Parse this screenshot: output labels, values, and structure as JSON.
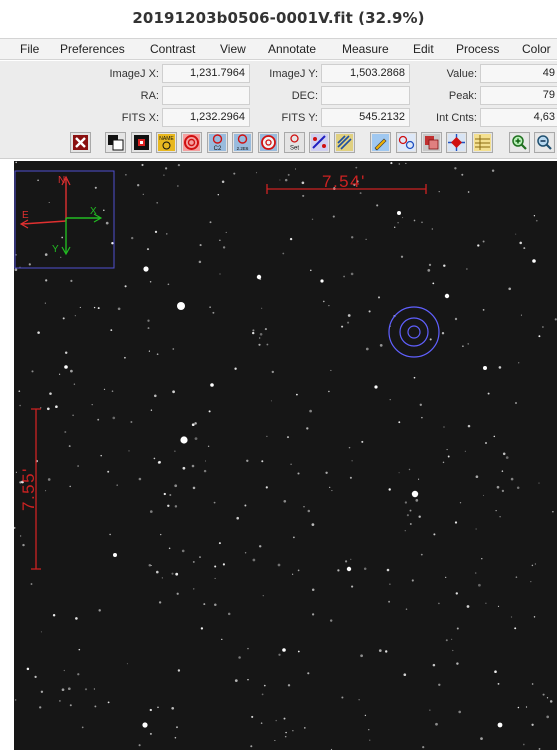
{
  "window": {
    "title": "20191203b0506-0001V.fit (32.9%)"
  },
  "menu": [
    "File",
    "Preferences",
    "Contrast",
    "View",
    "Annotate",
    "Measure",
    "Edit",
    "Process",
    "Color"
  ],
  "info": {
    "imagej_x_label": "ImageJ X:",
    "imagej_x": "1,231.7964",
    "imagej_y_label": "ImageJ Y:",
    "imagej_y": "1,503.2868",
    "value_label": "Value:",
    "value": "49",
    "ra_label": "RA:",
    "ra": "",
    "dec_label": "DEC:",
    "dec": "",
    "peak_label": "Peak:",
    "peak": "79",
    "fits_x_label": "FITS X:",
    "fits_x": "1,232.2964",
    "fits_y_label": "FITS Y:",
    "fits_y": "545.2132",
    "int_cnts_label": "Int Cnts:",
    "int_cnts": "4,63"
  },
  "toolbar": {
    "name_label": "NAME",
    "c2_label": "C2",
    "c2_value": "2.2E6",
    "set_label": "Set"
  },
  "overlay": {
    "scale_horizontal": "7.54'",
    "scale_vertical": "7.55'",
    "compass": {
      "north": "N",
      "east": "E",
      "x": "X",
      "y": "Y"
    }
  },
  "colors": {
    "scale_bar": "#cc2222",
    "aperture": "#6060ff",
    "compass_box": "#5050d0",
    "north_east_arrows": "#e03030",
    "x_y_arrows": "#22bb22",
    "sky_background": "#161616"
  }
}
